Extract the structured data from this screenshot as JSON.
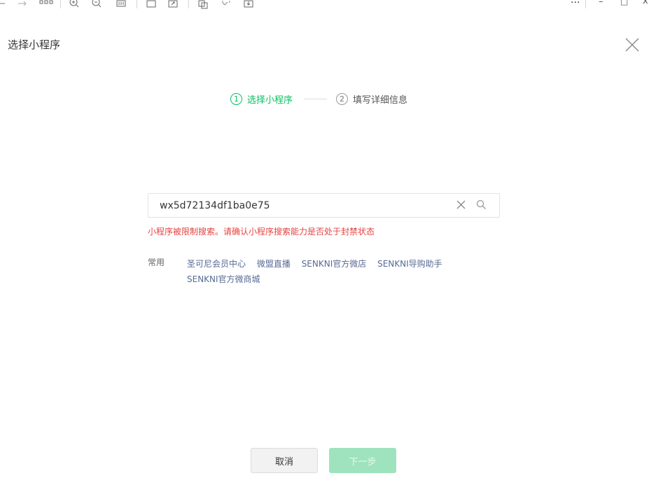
{
  "window": {
    "more_label": "···",
    "minimize_label": "–",
    "maximize_label": "□",
    "close_label": "x"
  },
  "dialog": {
    "title": "选择小程序"
  },
  "steps": [
    {
      "number": "1",
      "label": "选择小程序",
      "state": "active"
    },
    {
      "number": "2",
      "label": "填写详细信息",
      "state": "todo"
    }
  ],
  "search": {
    "value": "wx5d72134df1ba0e75",
    "placeholder": ""
  },
  "error": {
    "message": "小程序被限制搜索。请确认小程序搜索能力是否处于封禁状态"
  },
  "common": {
    "label": "常用",
    "items": [
      "圣可尼会员中心",
      "微盟直播",
      "SENKNI官方微店",
      "SENKNI导购助手",
      "SENKNI官方微商城"
    ]
  },
  "footer": {
    "cancel_label": "取消",
    "next_label": "下一步"
  },
  "colors": {
    "accent": "#07c160",
    "error": "#e64340",
    "link": "#576b95",
    "next_disabled": "#9ee3bd"
  }
}
